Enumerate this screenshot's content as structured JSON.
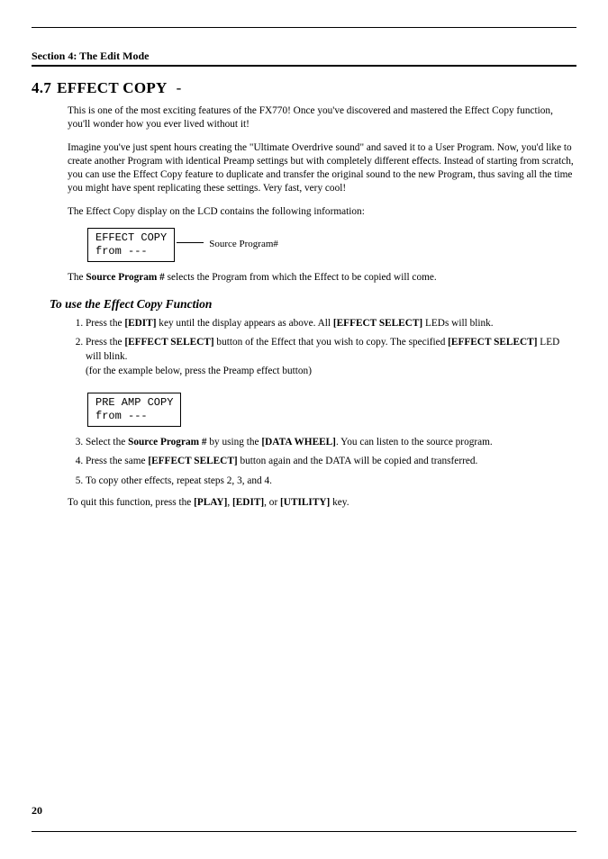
{
  "section_header": "Section 4: The Edit Mode",
  "heading_number": "4.7",
  "heading_title": "EFFECT COPY",
  "heading_dash": "-",
  "para1": "This is one of the most exciting features of the FX770! Once you've discovered and mastered the Effect Copy function, you'll wonder how you ever lived without it!",
  "para2": "Imagine you've just spent hours creating the \"Ultimate Overdrive sound\" and saved it to a User Program. Now, you'd like to create another Program with identical Preamp settings but with completely different effects. Instead of starting from scratch, you can use the Effect Copy feature to duplicate and transfer the original sound to the new Program, thus saving all the time you might have spent replicating these settings. Very fast, very cool!",
  "para3": "The Effect Copy display on the LCD contains the following information:",
  "lcd1_line1": "EFFECT COPY",
  "lcd1_line2": " from ---",
  "lcd1_annot": "Source Program#",
  "para4_pre": "The ",
  "para4_b": "Source Program #",
  "para4_post": " selects the Program from which the Effect to be copied will come.",
  "subheading": "To use the Effect Copy Function",
  "steps": {
    "s1_a": "Press the ",
    "s1_b1": "[EDIT]",
    "s1_c": " key until the display appears as above. All ",
    "s1_b2": "[EFFECT SELECT]",
    "s1_d": " LEDs will blink.",
    "s2_a": "Press the ",
    "s2_b1": "[EFFECT SELECT]",
    "s2_c": " button of the Effect that you wish to copy. The specified ",
    "s2_b2": "[EFFECT SELECT]",
    "s2_d": " LED will blink.",
    "s2_sub": "(for the example below, press the Preamp effect button)",
    "s3_a": "Select the ",
    "s3_b1": "Source Program #",
    "s3_c": " by using the ",
    "s3_b2": "[DATA WHEEL]",
    "s3_d": ". You can listen to the source program.",
    "s4_a": "Press the same ",
    "s4_b1": "[EFFECT SELECT]",
    "s4_c": " button again and the DATA will be copied and transferred.",
    "s5": "To copy other effects, repeat steps 2, 3, and 4."
  },
  "lcd2_line1": "PRE AMP COPY",
  "lcd2_line2": "  from ---",
  "closing_a": "To quit this function, press the ",
  "closing_b1": "[PLAY]",
  "closing_c": ", ",
  "closing_b2": "[EDIT]",
  "closing_d": ", or ",
  "closing_b3": "[UTILITY]",
  "closing_e": " key.",
  "page_number": "20"
}
